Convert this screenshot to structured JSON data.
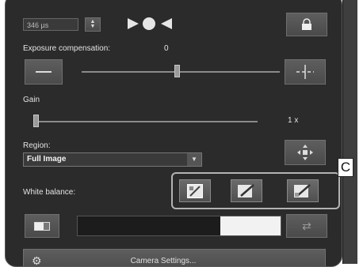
{
  "exposure": {
    "value": "346 µs"
  },
  "exposure_compensation": {
    "label": "Exposure compensation:",
    "value": "0",
    "level": 0.48
  },
  "gain": {
    "label": "Gain",
    "value": "1 x",
    "level": 0.0
  },
  "region": {
    "label": "Region:",
    "selected": "Full Image"
  },
  "white_balance": {
    "label": "White balance:"
  },
  "callout": {
    "letter": "C"
  },
  "camera_settings": {
    "label": "Camera Settings..."
  },
  "colors": {
    "panel": "#2b2b2b",
    "button": "#555555",
    "swatch": "#f0f0f0"
  }
}
